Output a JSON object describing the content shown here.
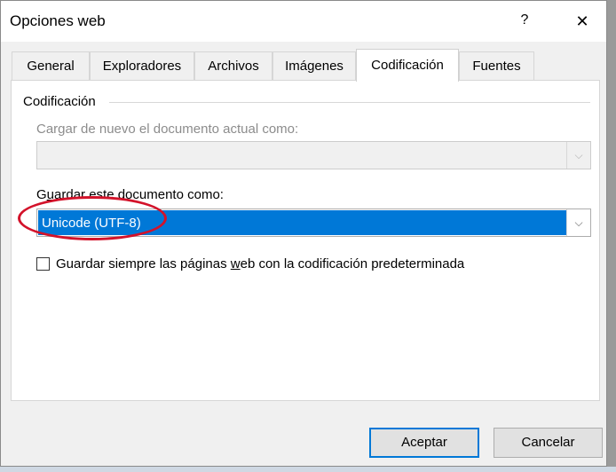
{
  "window": {
    "title": "Opciones web",
    "help_symbol": "?",
    "close_symbol": "✕"
  },
  "tabs": [
    {
      "label": "General",
      "active": false
    },
    {
      "label": "Exploradores",
      "active": false
    },
    {
      "label": "Archivos",
      "active": false
    },
    {
      "label": "Imágenes",
      "active": false
    },
    {
      "label": "Codificación",
      "active": true
    },
    {
      "label": "Fuentes",
      "active": false
    }
  ],
  "encoding_group": {
    "title": "Codificación",
    "reload_label": "Cargar de nuevo el documento actual como:",
    "reload_value": "",
    "save_label_pre": "G",
    "save_label_underline": "u",
    "save_label_post": "ardar este documento como:",
    "save_value": "Unicode (UTF-8)",
    "always_default_label_pre": "Guardar siempre las páginas ",
    "always_default_label_underline": "w",
    "always_default_label_post": "eb con la codificación predeterminada",
    "always_default_checked": false
  },
  "buttons": {
    "accept": "Aceptar",
    "cancel": "Cancelar"
  },
  "colors": {
    "selection": "#0078d7",
    "annotation": "#d3122a"
  }
}
